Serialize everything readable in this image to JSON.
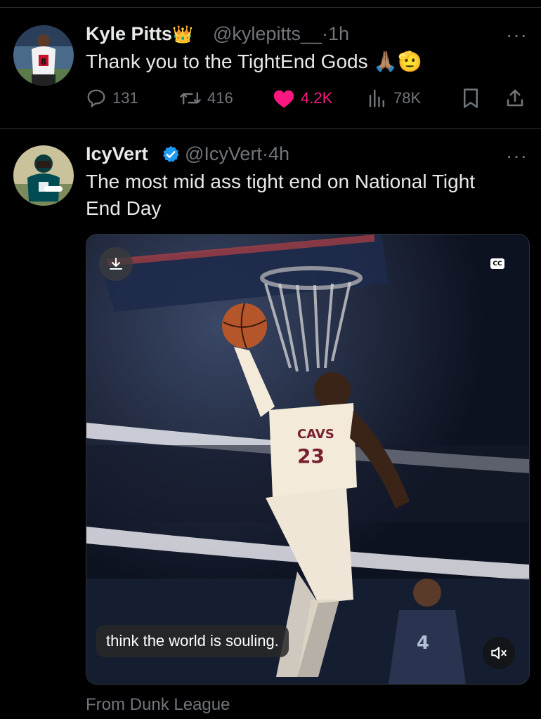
{
  "tweets": [
    {
      "name": "Kyle Pitts",
      "name_emoji": "👑",
      "handle": "@kylepitts__",
      "separator": "·",
      "time": "1h",
      "text": "Thank you to the TightEnd Gods 🙏🏽🫡",
      "more": "···",
      "actions": {
        "replies": "131",
        "reposts": "416",
        "likes": "4.2K",
        "views": "78K"
      }
    },
    {
      "name": "IcyVert",
      "handle": "@IcyVert",
      "separator": "·",
      "time": "4h",
      "verified": true,
      "text": "The most mid ass tight end on National Tight End Day",
      "more": "···",
      "media": {
        "cc_label": "CC",
        "caption": "think the world is souling.",
        "jersey_text": "CAVS",
        "jersey_number": "23"
      },
      "source": "From Dunk League"
    }
  ],
  "colors": {
    "background": "#000000",
    "text": "#e7e9ea",
    "secondary": "#71767b",
    "like": "#f91880",
    "verified": "#1d9bf0",
    "divider": "#2f3336"
  }
}
